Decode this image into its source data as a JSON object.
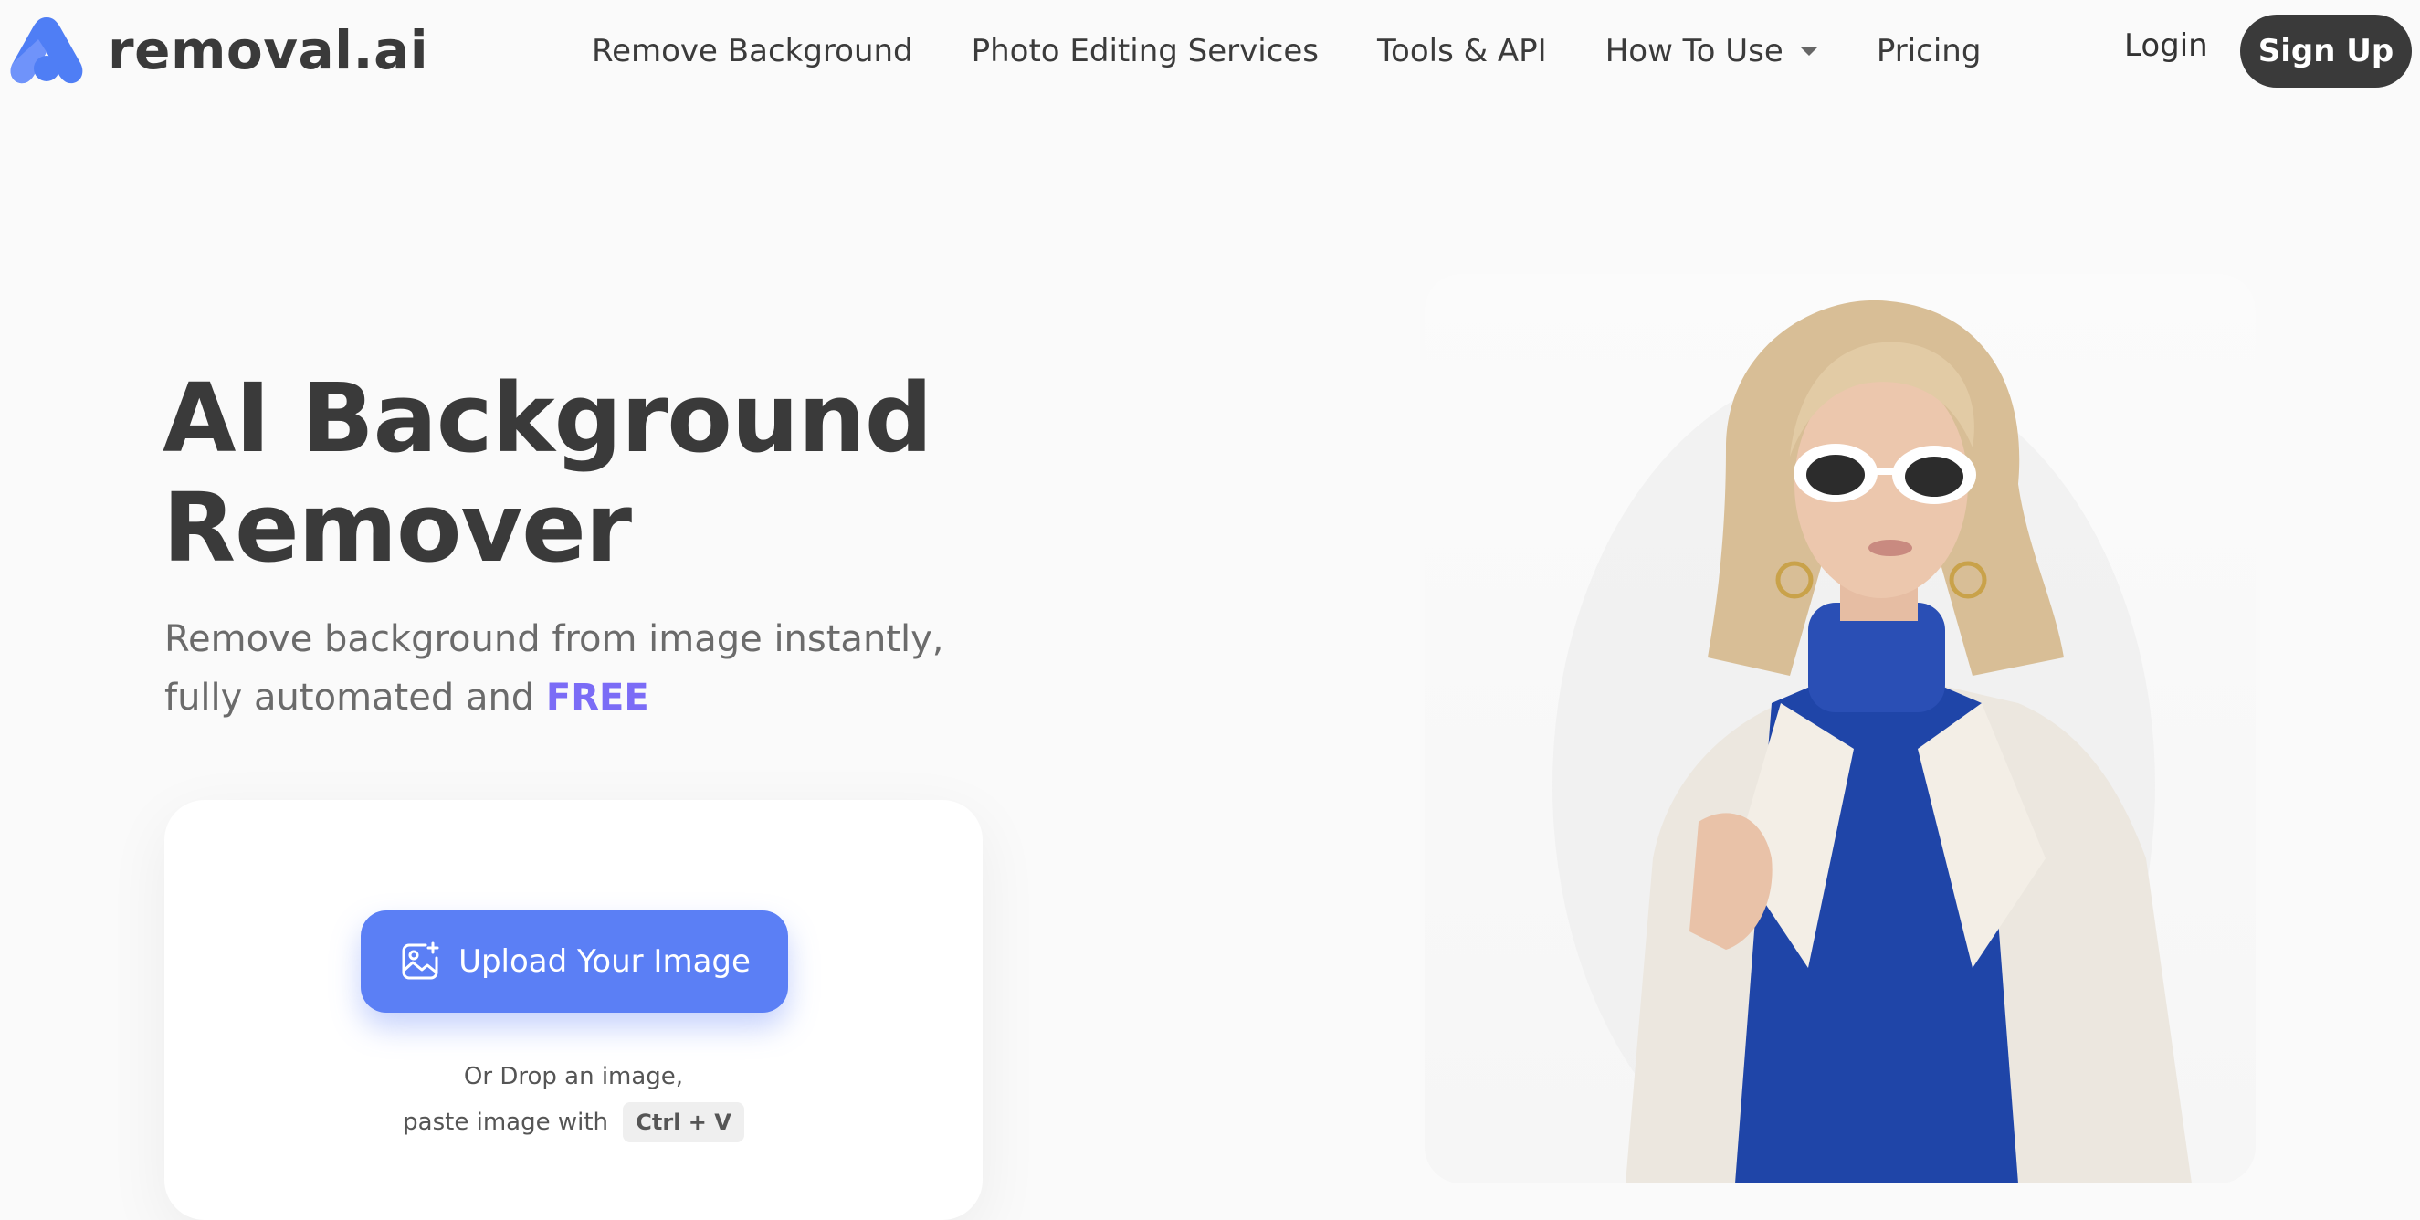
{
  "brand": {
    "name": "removal.ai",
    "logo_icon": "removal-logo-icon"
  },
  "nav": {
    "items": [
      {
        "label": "Remove Background"
      },
      {
        "label": "Photo Editing Services"
      },
      {
        "label": "Tools & API"
      },
      {
        "label": "How To Use",
        "has_dropdown": true
      },
      {
        "label": "Pricing"
      }
    ],
    "login": "Login",
    "signup": "Sign Up"
  },
  "hero": {
    "title_line1": "AI Background",
    "title_line2": "Remover",
    "sub_line1": "Remove background from image instantly,",
    "sub_line2": "fully automated and ",
    "sub_free": "FREE"
  },
  "upload": {
    "button_label": "Upload Your Image",
    "button_icon": "image-upload-icon",
    "drop_line1": "Or Drop an image,",
    "drop_line2": "paste image with",
    "shortcut": "Ctrl + V"
  },
  "colors": {
    "primary": "#5b7ff5",
    "accent_free": "#7b6cf6",
    "dark": "#3a3a3a",
    "background": "#fafafa"
  }
}
